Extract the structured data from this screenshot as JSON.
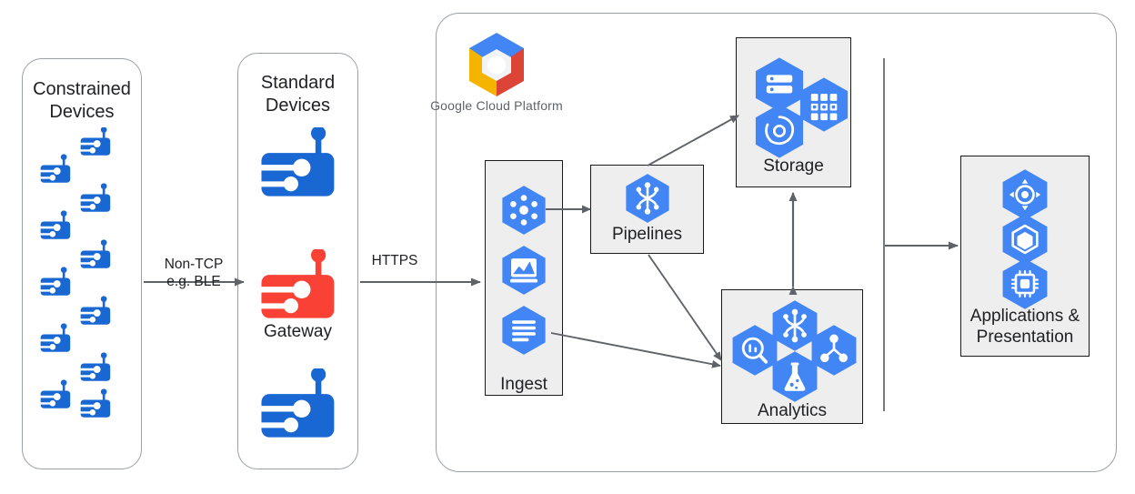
{
  "diagram": {
    "title": "Google Cloud Platform IoT reference architecture",
    "colors": {
      "device_blue": "#1967D2",
      "gateway_red": "#F94235",
      "hex_blue": "#4285F4",
      "group_fill": "#EEEEEE",
      "group_stroke": "#1A1A1A",
      "container_stroke": "#9AA0A6",
      "arrow_gray": "#5F6368",
      "gcp_logo_blue": "#4285F4",
      "gcp_logo_red": "#DB4437",
      "gcp_logo_yellow": "#F4B400",
      "wordmark_gray": "#5F6368"
    }
  },
  "containers": {
    "constrained_devices": {
      "title": "Constrained\nDevices",
      "device_count": 11,
      "device_icon": "iot-device-icon"
    },
    "standard_devices": {
      "title": "Standard\nDevices",
      "device_icon": "iot-device-icon",
      "devices": [
        {
          "name": "standard-device-top",
          "label": "",
          "color": "#1967D2"
        },
        {
          "name": "gateway-device",
          "label": "Gateway",
          "color": "#F94235"
        },
        {
          "name": "standard-device-bottom",
          "label": "",
          "color": "#1967D2"
        }
      ]
    },
    "google_cloud_platform": {
      "wordmark": "Google Cloud Platform",
      "logo_icon": "google-cloud-platform-logo"
    }
  },
  "edges": [
    {
      "name": "edge-constrained-to-gateway",
      "label": "Non-TCP\ne.g. BLE"
    },
    {
      "name": "edge-gateway-to-cloud",
      "label": "HTTPS"
    },
    {
      "name": "edge-ingest-to-pipelines",
      "label": ""
    },
    {
      "name": "edge-pipelines-to-storage",
      "label": ""
    },
    {
      "name": "edge-pipelines-to-analytics",
      "label": ""
    },
    {
      "name": "edge-ingest-to-analytics",
      "label": ""
    },
    {
      "name": "edge-storage-analytics-bidirectional",
      "label": ""
    },
    {
      "name": "edge-cloud-to-applications",
      "label": ""
    }
  ],
  "groups": [
    {
      "name": "ingest-group",
      "label": "Ingest",
      "icons": [
        {
          "name": "pubsub-icon",
          "glyph": "pubsub"
        },
        {
          "name": "monitoring-icon",
          "glyph": "monitoring"
        },
        {
          "name": "logging-icon",
          "glyph": "logging"
        }
      ]
    },
    {
      "name": "pipelines-group",
      "label": "Pipelines",
      "icons": [
        {
          "name": "dataflow-icon",
          "glyph": "dataflow"
        }
      ]
    },
    {
      "name": "storage-group",
      "label": "Storage",
      "icons": [
        {
          "name": "cloud-sql-icon",
          "glyph": "database"
        },
        {
          "name": "bigtable-icon",
          "glyph": "grid"
        },
        {
          "name": "cloud-storage-icon",
          "glyph": "bucket"
        }
      ]
    },
    {
      "name": "analytics-group",
      "label": "Analytics",
      "icons": [
        {
          "name": "dataflow-icon",
          "glyph": "dataflow"
        },
        {
          "name": "bigquery-icon",
          "glyph": "magnifier"
        },
        {
          "name": "dataproc-icon",
          "glyph": "nodes"
        },
        {
          "name": "datalab-icon",
          "glyph": "flask"
        }
      ]
    },
    {
      "name": "applications-group",
      "label": "Applications &\nPresentation",
      "icons": [
        {
          "name": "app-engine-icon",
          "glyph": "target"
        },
        {
          "name": "container-engine-icon",
          "glyph": "cube"
        },
        {
          "name": "iot-core-icon",
          "glyph": "chip"
        }
      ]
    }
  ]
}
